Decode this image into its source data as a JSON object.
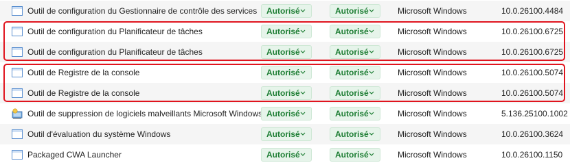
{
  "colors": {
    "accent_green": "#1e7e34",
    "pill_background": "#e6f4ea",
    "highlight_red": "#e0141e"
  },
  "rows": [
    {
      "icon": "window-app-icon",
      "name": "Outil de configuration du Gestionnaire de contrôle des services",
      "status1": "Autorisé",
      "status2": "Autorisé",
      "publisher": "Microsoft Windows",
      "version": "10.0.26100.4484"
    },
    {
      "icon": "window-app-icon",
      "name": "Outil de configuration du Planificateur de tâches",
      "status1": "Autorisé",
      "status2": "Autorisé",
      "publisher": "Microsoft Windows",
      "version": "10.0.26100.6725"
    },
    {
      "icon": "window-app-icon",
      "name": "Outil de configuration du Planificateur de tâches",
      "status1": "Autorisé",
      "status2": "Autorisé",
      "publisher": "Microsoft Windows",
      "version": "10.0.26100.6725"
    },
    {
      "icon": "window-app-icon",
      "name": "Outil de Registre de la console",
      "status1": "Autorisé",
      "status2": "Autorisé",
      "publisher": "Microsoft Windows",
      "version": "10.0.26100.5074"
    },
    {
      "icon": "window-app-icon",
      "name": "Outil de Registre de la console",
      "status1": "Autorisé",
      "status2": "Autorisé",
      "publisher": "Microsoft Windows",
      "version": "10.0.26100.5074"
    },
    {
      "icon": "malware-removal-icon",
      "name": "Outil de suppression de logiciels malveillants Microsoft Windows",
      "status1": "Autorisé",
      "status2": "Autorisé",
      "publisher": "Microsoft Windows",
      "version": "5.136.25100.1002"
    },
    {
      "icon": "window-app-icon",
      "name": "Outil d'évaluation du système Windows",
      "status1": "Autorisé",
      "status2": "Autorisé",
      "publisher": "Microsoft Windows",
      "version": "10.0.26100.3624"
    },
    {
      "icon": "window-app-icon",
      "name": "Packaged CWA Launcher",
      "status1": "Autorisé",
      "status2": "Autorisé",
      "publisher": "Microsoft Windows",
      "version": "10.0.26100.1150"
    }
  ]
}
